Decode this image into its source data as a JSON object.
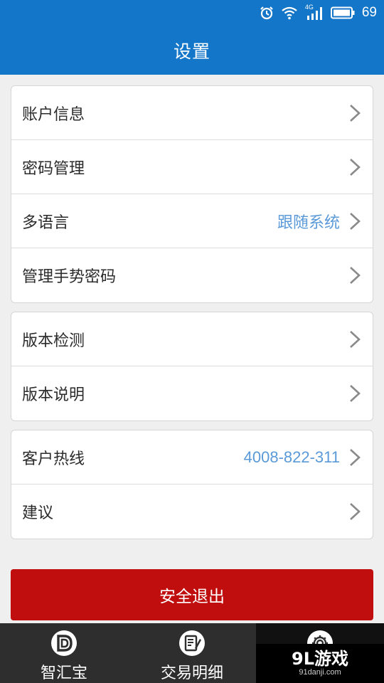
{
  "status_bar": {
    "network_label": "4G",
    "battery_level": "69"
  },
  "header": {
    "title": "设置"
  },
  "groups": [
    {
      "items": [
        {
          "label": "账户信息",
          "value": ""
        },
        {
          "label": "密码管理",
          "value": ""
        },
        {
          "label": "多语言",
          "value": "跟随系统"
        },
        {
          "label": "管理手势密码",
          "value": ""
        }
      ]
    },
    {
      "items": [
        {
          "label": "版本检测",
          "value": ""
        },
        {
          "label": "版本说明",
          "value": ""
        }
      ]
    },
    {
      "items": [
        {
          "label": "客户热线",
          "value": "4008-822-311"
        },
        {
          "label": "建议",
          "value": ""
        }
      ]
    }
  ],
  "logout_button": {
    "label": "安全退出"
  },
  "tabs": [
    {
      "label": "智汇宝",
      "icon": "d-logo-icon"
    },
    {
      "label": "交易明细",
      "icon": "document-edit-icon"
    },
    {
      "label": "",
      "icon": "gear-icon"
    }
  ],
  "watermark": {
    "main": "9L游戏",
    "sub": "91danji.com"
  },
  "colors": {
    "header_blue": "#1476c8",
    "value_blue": "#5a9ad8",
    "logout_red": "#c00d0d",
    "tabbar_dark": "#2e2e2e"
  }
}
